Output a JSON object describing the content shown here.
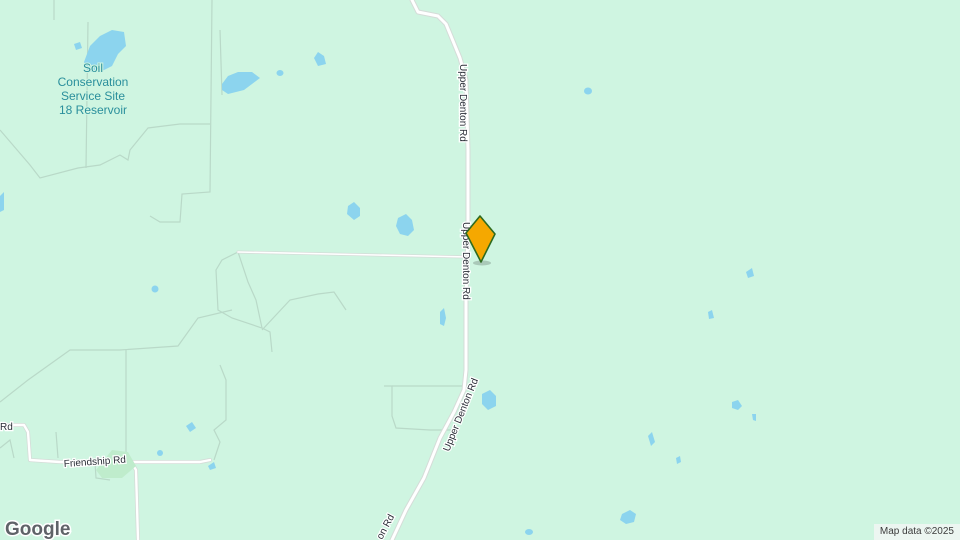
{
  "map": {
    "roads": {
      "upper_denton_1": "Upper Denton Rd",
      "upper_denton_2": "Upper Denton Rd",
      "upper_denton_3": "Upper Denton Rd",
      "upper_denton_4": "on Rd",
      "friendship": "Friendship Rd",
      "left_rd": "Rd"
    },
    "places": {
      "reservoir_line1": "Soil",
      "reservoir_line2": "Conservation",
      "reservoir_line3": "Service Site",
      "reservoir_line4": "18 Reservoir"
    },
    "marker": {
      "icon": "location-pin-icon",
      "color": "#f5a800",
      "stroke": "#2e6b1f"
    },
    "colors": {
      "land": "#cff5e1",
      "water": "#8cd4ee",
      "road": "#ffffff",
      "trail": "#b8d6c6",
      "water_label": "#2a8f9c"
    }
  },
  "footer": {
    "logo": "Google",
    "attribution": "Map data ©2025"
  }
}
